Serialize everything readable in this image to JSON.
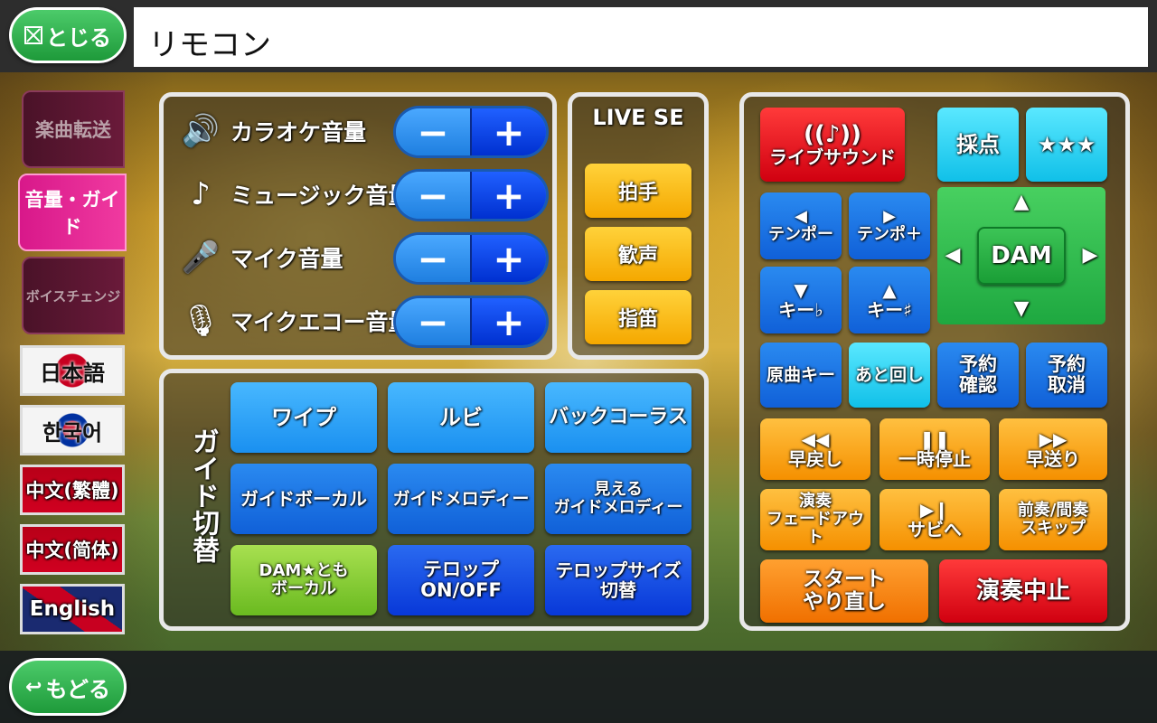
{
  "header": {
    "close_label": "とじる",
    "title": "リモコン"
  },
  "footer": {
    "back_label": "もどる"
  },
  "sidebar": {
    "tabs": [
      {
        "label": "楽曲転送"
      },
      {
        "label": "音量・ガイド"
      },
      {
        "label": "ボイスチェンジ"
      }
    ],
    "languages": [
      {
        "label": "日本語"
      },
      {
        "label": "한국어"
      },
      {
        "label": "中文(繁體)"
      },
      {
        "label": "中文(简体)"
      },
      {
        "label": "English"
      }
    ]
  },
  "volume": {
    "rows": [
      {
        "label": "カラオケ音量",
        "icon": "speaker-icon"
      },
      {
        "label": "ミュージック音量",
        "icon": "music-note-icon"
      },
      {
        "label": "マイク音量",
        "icon": "microphone-icon"
      },
      {
        "label": "マイクエコー音量",
        "icon": "mic-echo-icon"
      }
    ],
    "minus": "−",
    "plus": "+"
  },
  "live_se": {
    "title": "LIVE SE",
    "buttons": [
      {
        "label": "拍手"
      },
      {
        "label": "歓声"
      },
      {
        "label": "指笛"
      }
    ]
  },
  "guide": {
    "title": "ガイド切替",
    "buttons": [
      {
        "label": "ワイプ"
      },
      {
        "label": "ルビ"
      },
      {
        "label": "バックコーラス"
      },
      {
        "label": "ガイドボーカル"
      },
      {
        "label": "ガイドメロディー"
      },
      {
        "label": "見える\nガイドメロディー"
      },
      {
        "label": "DAM★とも\nボーカル"
      },
      {
        "label": "テロップ\nON/OFF"
      },
      {
        "label": "テロップサイズ\n切替"
      }
    ]
  },
  "remote": {
    "live_sound": "ライブサウンド",
    "score": "採点",
    "stars": "★★★",
    "tempo_down": "テンポー",
    "tempo_up": "テンポ＋",
    "key_down": "キー♭",
    "key_up": "キー♯",
    "dam": "DAM",
    "original_key": "原曲キー",
    "replay": "あと回し",
    "reserve_confirm": "予約\n確認",
    "reserve_cancel": "予約\n取消",
    "rewind": "早戻し",
    "pause": "一時停止",
    "forward": "早送り",
    "fadeout": "演奏\nフェードアウト",
    "to_chorus": "サビへ",
    "skip_intro": "前奏/間奏\nスキップ",
    "restart": "スタート\nやり直し",
    "stop": "演奏中止"
  },
  "colors": {
    "accent_pink": "#e8208e",
    "green": "#2eb84e",
    "blue": "#1a6ef0"
  }
}
